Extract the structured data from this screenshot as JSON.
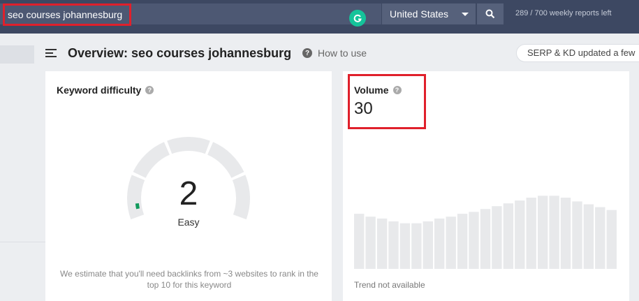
{
  "search": {
    "value": "seo courses johannesburg",
    "placeholder": ""
  },
  "country": {
    "selected": "United States"
  },
  "reports": {
    "text": "289 / 700 weekly reports left"
  },
  "header": {
    "title": "Overview: seo courses johannesburg",
    "help_label": "How to use",
    "help_icon_glyph": "?",
    "serp_status": "SERP & KD updated a few"
  },
  "keyword_difficulty": {
    "title": "Keyword difficulty",
    "value": "2",
    "rating": "Easy",
    "level_fraction": 0.02,
    "note": "We estimate that you'll need backlinks from ~3 websites to rank in the top 10 for this keyword",
    "accent_color": "#119a5c"
  },
  "volume": {
    "title": "Volume",
    "value": "30",
    "trend_note": "Trend not available",
    "trend_levels": [
      0.58,
      0.55,
      0.53,
      0.5,
      0.48,
      0.48,
      0.5,
      0.53,
      0.55,
      0.58,
      0.6,
      0.63,
      0.66,
      0.69,
      0.72,
      0.75,
      0.77,
      0.77,
      0.75,
      0.71,
      0.68,
      0.65,
      0.62
    ]
  },
  "colors": {
    "topbar": "#3d4862",
    "highlight": "#e0202b",
    "grammarly": "#15c39a"
  }
}
